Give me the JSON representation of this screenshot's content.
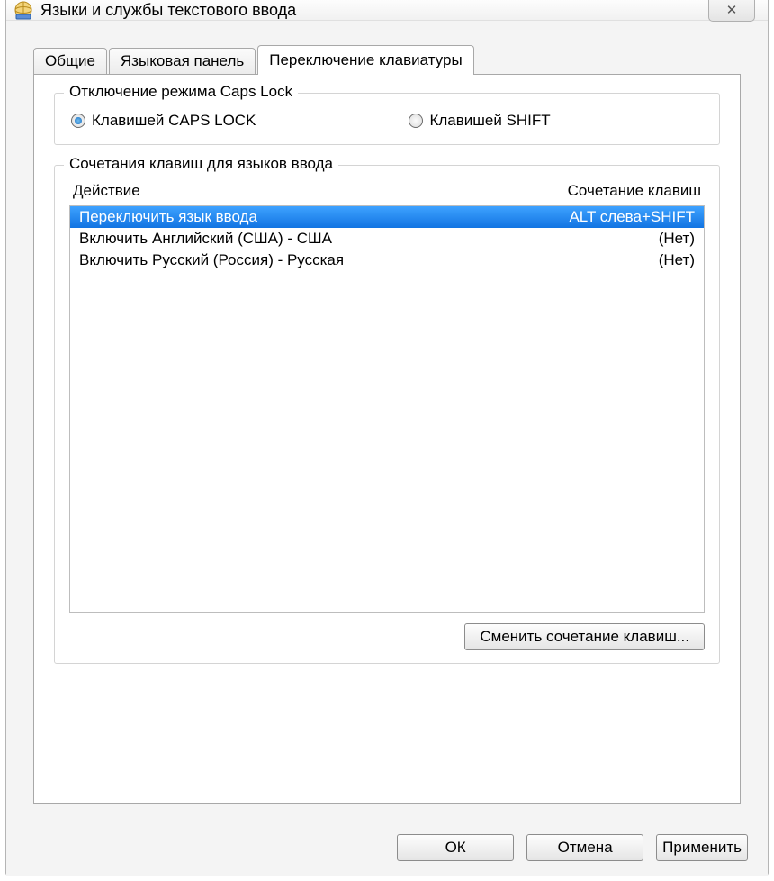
{
  "window": {
    "title": "Языки и службы текстового ввода",
    "close_glyph": "✕"
  },
  "tabs": {
    "general": "Общие",
    "langbar": "Языковая панель",
    "keyswitch": "Переключение клавиатуры"
  },
  "caps_group": {
    "title": "Отключение режима Caps Lock",
    "opt_caps": "Клавишей CAPS LOCK",
    "opt_shift": "Клавишей SHIFT"
  },
  "hotkeys_group": {
    "title": "Сочетания клавиш для языков ввода",
    "col_action": "Действие",
    "col_combo": "Сочетание клавиш",
    "rows": [
      {
        "action": "Переключить язык ввода",
        "combo": "ALT слева+SHIFT",
        "selected": true
      },
      {
        "action": "Включить Английский (США) - США",
        "combo": "(Нет)",
        "selected": false
      },
      {
        "action": "Включить Русский (Россия) - Русская",
        "combo": "(Нет)",
        "selected": false
      }
    ],
    "change_btn": "Сменить сочетание клавиш..."
  },
  "footer": {
    "ok": "ОК",
    "cancel": "Отмена",
    "apply": "Применить"
  }
}
